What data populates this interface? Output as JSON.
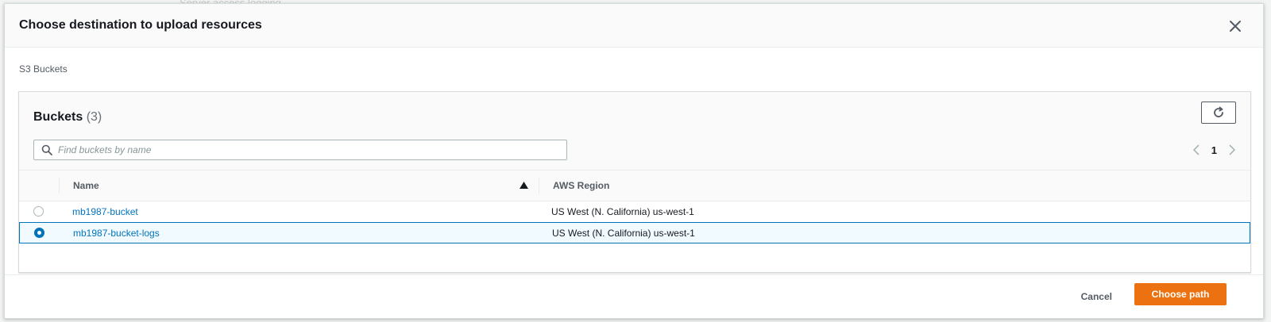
{
  "backdrop": {
    "text": "Server access logging"
  },
  "modal": {
    "title": "Choose destination to upload resources",
    "close_icon": "close-icon"
  },
  "section": {
    "label": "S3 Buckets"
  },
  "panel": {
    "title": "Buckets",
    "count": "(3)",
    "refresh_icon": "refresh-icon"
  },
  "search": {
    "placeholder": "Find buckets by name",
    "value": ""
  },
  "pagination": {
    "current_page": "1"
  },
  "table": {
    "columns": [
      "Name",
      "AWS Region"
    ],
    "sort": {
      "column": "Name",
      "direction": "ascending"
    },
    "rows": [
      {
        "name": "mb1987-bucket",
        "region": "US West (N. California) us-west-1",
        "selected": false
      },
      {
        "name": "mb1987-bucket-logs",
        "region": "US West (N. California) us-west-1",
        "selected": true
      }
    ]
  },
  "footer": {
    "cancel_label": "Cancel",
    "primary_label": "Choose path"
  },
  "colors": {
    "accent": "#ec7211",
    "link": "#0073bb",
    "selected_bg": "#f1faff"
  }
}
